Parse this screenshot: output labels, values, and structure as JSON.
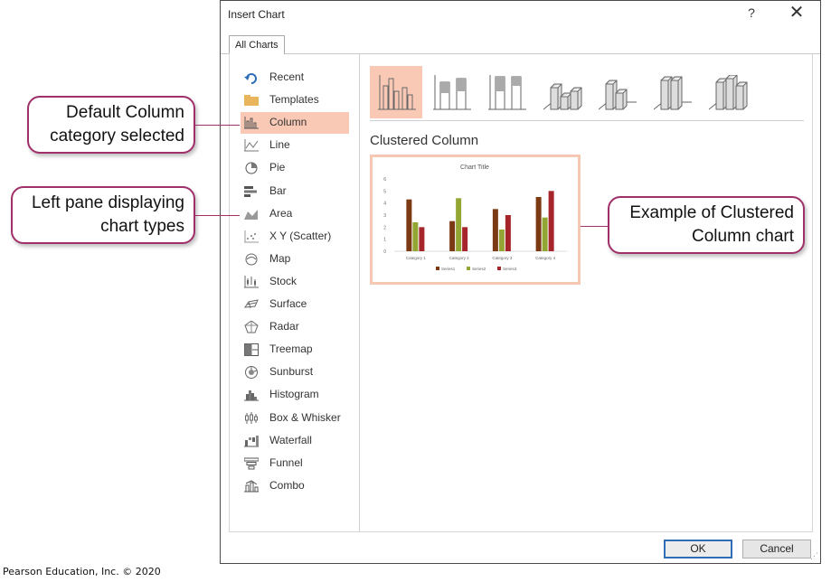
{
  "dialog": {
    "title": "Insert Chart",
    "help": "?",
    "close": "✕",
    "tab": "All Charts",
    "ok": "OK",
    "cancel": "Cancel"
  },
  "chart_types": [
    {
      "label": "Recent",
      "icon": "recent-icon"
    },
    {
      "label": "Templates",
      "icon": "folder-icon"
    },
    {
      "label": "Column",
      "icon": "column-chart-icon",
      "selected": true
    },
    {
      "label": "Line",
      "icon": "line-chart-icon"
    },
    {
      "label": "Pie",
      "icon": "pie-chart-icon"
    },
    {
      "label": "Bar",
      "icon": "bar-chart-icon"
    },
    {
      "label": "Area",
      "icon": "area-chart-icon"
    },
    {
      "label": "X Y (Scatter)",
      "icon": "scatter-chart-icon"
    },
    {
      "label": "Map",
      "icon": "map-chart-icon"
    },
    {
      "label": "Stock",
      "icon": "stock-chart-icon"
    },
    {
      "label": "Surface",
      "icon": "surface-chart-icon"
    },
    {
      "label": "Radar",
      "icon": "radar-chart-icon"
    },
    {
      "label": "Treemap",
      "icon": "treemap-chart-icon"
    },
    {
      "label": "Sunburst",
      "icon": "sunburst-chart-icon"
    },
    {
      "label": "Histogram",
      "icon": "histogram-chart-icon"
    },
    {
      "label": "Box & Whisker",
      "icon": "box-whisker-chart-icon"
    },
    {
      "label": "Waterfall",
      "icon": "waterfall-chart-icon"
    },
    {
      "label": "Funnel",
      "icon": "funnel-chart-icon"
    },
    {
      "label": "Combo",
      "icon": "combo-chart-icon"
    }
  ],
  "subtypes": [
    {
      "icon": "clustered-column-icon",
      "selected": true
    },
    {
      "icon": "stacked-column-icon"
    },
    {
      "icon": "100-stacked-column-icon"
    },
    {
      "icon": "3d-clustered-column-icon"
    },
    {
      "icon": "3d-stacked-column-icon"
    },
    {
      "icon": "3d-100-stacked-column-icon"
    },
    {
      "icon": "3d-column-icon"
    }
  ],
  "subtype_title": "Clustered Column",
  "chart_data": {
    "type": "bar",
    "title": "Chart Title",
    "categories": [
      "Category 1",
      "Category 2",
      "Category 3",
      "Category 4"
    ],
    "series": [
      {
        "name": "Series1",
        "values": [
          4.3,
          2.5,
          3.5,
          4.5
        ],
        "color": "#7b3a14"
      },
      {
        "name": "Series2",
        "values": [
          2.4,
          4.4,
          1.8,
          2.8
        ],
        "color": "#93a634"
      },
      {
        "name": "Series3",
        "values": [
          2,
          2,
          3,
          5
        ],
        "color": "#a6252a"
      }
    ],
    "ylim": [
      0,
      6
    ],
    "yticks": [
      "0",
      "1",
      "2",
      "3",
      "4",
      "5",
      "6"
    ],
    "legend": "bottom"
  },
  "callouts": {
    "column": "Default Column category selected",
    "column_lines": [
      "Default Column",
      "category selected"
    ],
    "left_pane_lines": [
      "Left pane displaying",
      "chart types"
    ],
    "example_lines": [
      "Example of Clustered",
      "Column chart"
    ]
  },
  "copyright": "Pearson Education, Inc. © 2020",
  "colors": {
    "selection": "#f9c9b5",
    "callout_border": "#a0306a",
    "ok_border": "#2f6db5"
  }
}
